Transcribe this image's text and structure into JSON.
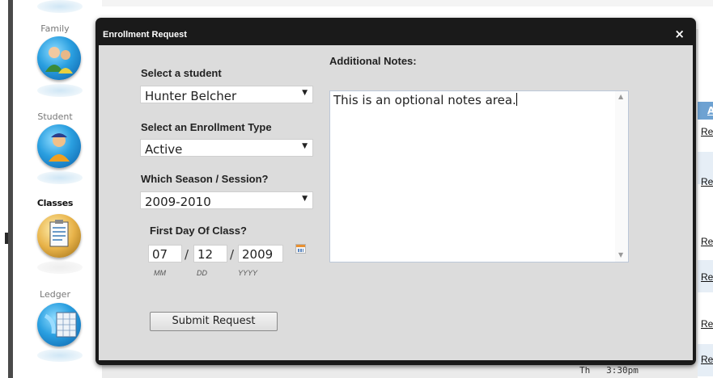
{
  "sidebar": {
    "items": [
      {
        "label": "Family",
        "icon": "family-icon"
      },
      {
        "label": "Student",
        "icon": "student-icon"
      },
      {
        "label": "Classes",
        "icon": "classes-clipboard-icon",
        "active": true
      },
      {
        "label": "Ledger",
        "icon": "ledger-icon"
      }
    ]
  },
  "background": {
    "table_header": "A",
    "row_links": [
      "Re",
      "Re",
      "Re",
      "Re",
      "Re",
      "Re"
    ],
    "schedule_text": "Th   3:30pm"
  },
  "modal": {
    "title": "Enrollment Request",
    "close_glyph": "×",
    "student": {
      "label": "Select a student",
      "value": "Hunter Belcher"
    },
    "enrollment_type": {
      "label": "Select an Enrollment Type",
      "value": "Active"
    },
    "season": {
      "label": "Which Season / Session?",
      "value": "2009-2010"
    },
    "first_day": {
      "label": "First Day Of Class?",
      "month": "07",
      "day": "12",
      "year": "2009",
      "separator": "/",
      "hints": {
        "month": "MM",
        "day": "DD",
        "year": "YYYY"
      }
    },
    "notes": {
      "label": "Additional Notes:",
      "value": "This is an optional notes area."
    },
    "submit_label": "Submit Request"
  },
  "colors": {
    "modal_frame": "#1a1a1a",
    "modal_body": "#dcdcdc",
    "table_header": "#6ea2d2",
    "accent_orb": "#2a9fe0"
  }
}
